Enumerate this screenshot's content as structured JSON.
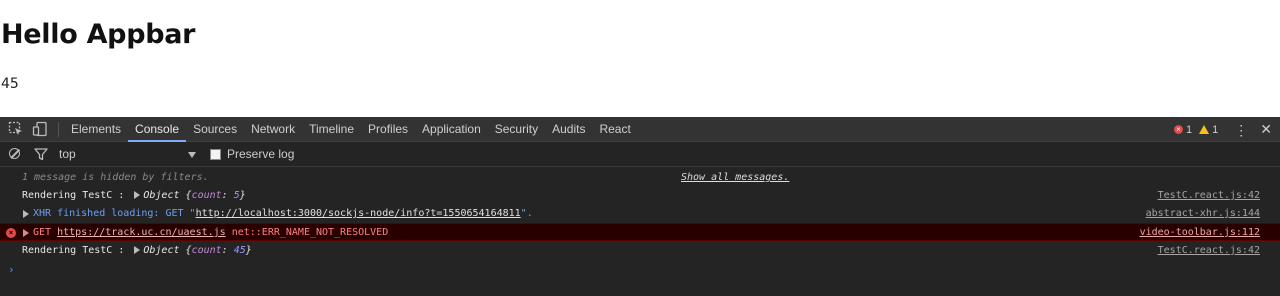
{
  "page": {
    "heading": "Hello Appbar",
    "count": "45"
  },
  "devtools": {
    "tabs": [
      {
        "label": "Elements",
        "active": false
      },
      {
        "label": "Console",
        "active": true
      },
      {
        "label": "Sources",
        "active": false
      },
      {
        "label": "Network",
        "active": false
      },
      {
        "label": "Timeline",
        "active": false
      },
      {
        "label": "Profiles",
        "active": false
      },
      {
        "label": "Application",
        "active": false
      },
      {
        "label": "Security",
        "active": false
      },
      {
        "label": "Audits",
        "active": false
      },
      {
        "label": "React",
        "active": false
      }
    ],
    "error_count": "1",
    "warning_count": "1",
    "filter": {
      "context": "top",
      "preserve_log_label": "Preserve log",
      "preserve_log_checked": false
    },
    "console": {
      "hidden_message": "1 message is hidden by filters.",
      "show_all": "Show all messages.",
      "entries": [
        {
          "prefix": "Rendering TestC : ",
          "object": "Object",
          "key": "count",
          "value": "5",
          "source": "TestC.react.js:42"
        },
        {
          "text": "XHR finished loading: GET \"",
          "url": "http://localhost:3000/sockjs-node/info?t=1550654164811",
          "suffix": "\".",
          "source": "abstract-xhr.js:144"
        },
        {
          "method": "GET ",
          "url": "https://track.uc.cn/uaest.js",
          "error": " net::ERR_NAME_NOT_RESOLVED",
          "source": "video-toolbar.js:112"
        },
        {
          "prefix": "Rendering TestC : ",
          "object": "Object",
          "key": "count",
          "value": "45",
          "source": "TestC.react.js:42"
        }
      ]
    }
  },
  "colors": {
    "panel_bg": "#242424",
    "tabbar_bg": "#333333",
    "active_tab_underline": "#7cacf8",
    "error_red": "#e14b4b",
    "warning_yellow": "#f4c21b",
    "xhr_blue": "#6c9ff2"
  }
}
